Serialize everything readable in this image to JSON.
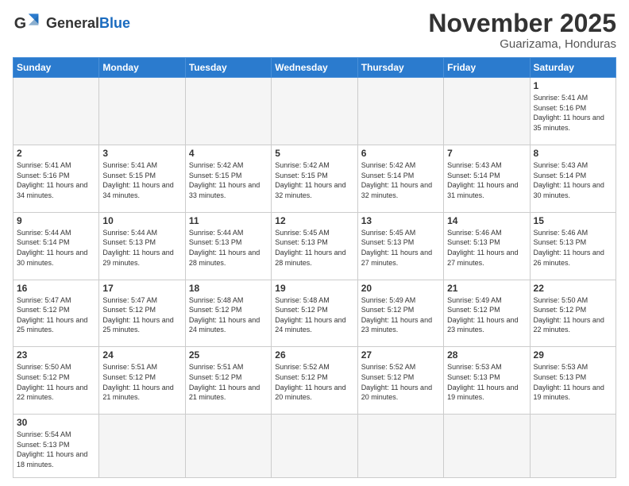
{
  "logo": {
    "text_general": "General",
    "text_blue": "Blue"
  },
  "header": {
    "month_title": "November 2025",
    "subtitle": "Guarizama, Honduras"
  },
  "weekdays": [
    "Sunday",
    "Monday",
    "Tuesday",
    "Wednesday",
    "Thursday",
    "Friday",
    "Saturday"
  ],
  "weeks": [
    [
      {
        "day": "",
        "empty": true
      },
      {
        "day": "",
        "empty": true
      },
      {
        "day": "",
        "empty": true
      },
      {
        "day": "",
        "empty": true
      },
      {
        "day": "",
        "empty": true
      },
      {
        "day": "",
        "empty": true
      },
      {
        "day": "1",
        "sunrise": "5:41 AM",
        "sunset": "5:16 PM",
        "daylight": "11 hours and 35 minutes."
      }
    ],
    [
      {
        "day": "2",
        "sunrise": "5:41 AM",
        "sunset": "5:16 PM",
        "daylight": "11 hours and 34 minutes."
      },
      {
        "day": "3",
        "sunrise": "5:41 AM",
        "sunset": "5:15 PM",
        "daylight": "11 hours and 34 minutes."
      },
      {
        "day": "4",
        "sunrise": "5:42 AM",
        "sunset": "5:15 PM",
        "daylight": "11 hours and 33 minutes."
      },
      {
        "day": "5",
        "sunrise": "5:42 AM",
        "sunset": "5:15 PM",
        "daylight": "11 hours and 32 minutes."
      },
      {
        "day": "6",
        "sunrise": "5:42 AM",
        "sunset": "5:14 PM",
        "daylight": "11 hours and 32 minutes."
      },
      {
        "day": "7",
        "sunrise": "5:43 AM",
        "sunset": "5:14 PM",
        "daylight": "11 hours and 31 minutes."
      },
      {
        "day": "8",
        "sunrise": "5:43 AM",
        "sunset": "5:14 PM",
        "daylight": "11 hours and 30 minutes."
      }
    ],
    [
      {
        "day": "9",
        "sunrise": "5:44 AM",
        "sunset": "5:14 PM",
        "daylight": "11 hours and 30 minutes."
      },
      {
        "day": "10",
        "sunrise": "5:44 AM",
        "sunset": "5:13 PM",
        "daylight": "11 hours and 29 minutes."
      },
      {
        "day": "11",
        "sunrise": "5:44 AM",
        "sunset": "5:13 PM",
        "daylight": "11 hours and 28 minutes."
      },
      {
        "day": "12",
        "sunrise": "5:45 AM",
        "sunset": "5:13 PM",
        "daylight": "11 hours and 28 minutes."
      },
      {
        "day": "13",
        "sunrise": "5:45 AM",
        "sunset": "5:13 PM",
        "daylight": "11 hours and 27 minutes."
      },
      {
        "day": "14",
        "sunrise": "5:46 AM",
        "sunset": "5:13 PM",
        "daylight": "11 hours and 27 minutes."
      },
      {
        "day": "15",
        "sunrise": "5:46 AM",
        "sunset": "5:13 PM",
        "daylight": "11 hours and 26 minutes."
      }
    ],
    [
      {
        "day": "16",
        "sunrise": "5:47 AM",
        "sunset": "5:12 PM",
        "daylight": "11 hours and 25 minutes."
      },
      {
        "day": "17",
        "sunrise": "5:47 AM",
        "sunset": "5:12 PM",
        "daylight": "11 hours and 25 minutes."
      },
      {
        "day": "18",
        "sunrise": "5:48 AM",
        "sunset": "5:12 PM",
        "daylight": "11 hours and 24 minutes."
      },
      {
        "day": "19",
        "sunrise": "5:48 AM",
        "sunset": "5:12 PM",
        "daylight": "11 hours and 24 minutes."
      },
      {
        "day": "20",
        "sunrise": "5:49 AM",
        "sunset": "5:12 PM",
        "daylight": "11 hours and 23 minutes."
      },
      {
        "day": "21",
        "sunrise": "5:49 AM",
        "sunset": "5:12 PM",
        "daylight": "11 hours and 23 minutes."
      },
      {
        "day": "22",
        "sunrise": "5:50 AM",
        "sunset": "5:12 PM",
        "daylight": "11 hours and 22 minutes."
      }
    ],
    [
      {
        "day": "23",
        "sunrise": "5:50 AM",
        "sunset": "5:12 PM",
        "daylight": "11 hours and 22 minutes."
      },
      {
        "day": "24",
        "sunrise": "5:51 AM",
        "sunset": "5:12 PM",
        "daylight": "11 hours and 21 minutes."
      },
      {
        "day": "25",
        "sunrise": "5:51 AM",
        "sunset": "5:12 PM",
        "daylight": "11 hours and 21 minutes."
      },
      {
        "day": "26",
        "sunrise": "5:52 AM",
        "sunset": "5:12 PM",
        "daylight": "11 hours and 20 minutes."
      },
      {
        "day": "27",
        "sunrise": "5:52 AM",
        "sunset": "5:12 PM",
        "daylight": "11 hours and 20 minutes."
      },
      {
        "day": "28",
        "sunrise": "5:53 AM",
        "sunset": "5:13 PM",
        "daylight": "11 hours and 19 minutes."
      },
      {
        "day": "29",
        "sunrise": "5:53 AM",
        "sunset": "5:13 PM",
        "daylight": "11 hours and 19 minutes."
      }
    ],
    [
      {
        "day": "30",
        "sunrise": "5:54 AM",
        "sunset": "5:13 PM",
        "daylight": "11 hours and 18 minutes."
      },
      {
        "day": "",
        "empty": true
      },
      {
        "day": "",
        "empty": true
      },
      {
        "day": "",
        "empty": true
      },
      {
        "day": "",
        "empty": true
      },
      {
        "day": "",
        "empty": true
      },
      {
        "day": "",
        "empty": true
      }
    ]
  ],
  "labels": {
    "sunrise": "Sunrise:",
    "sunset": "Sunset:",
    "daylight": "Daylight:"
  }
}
